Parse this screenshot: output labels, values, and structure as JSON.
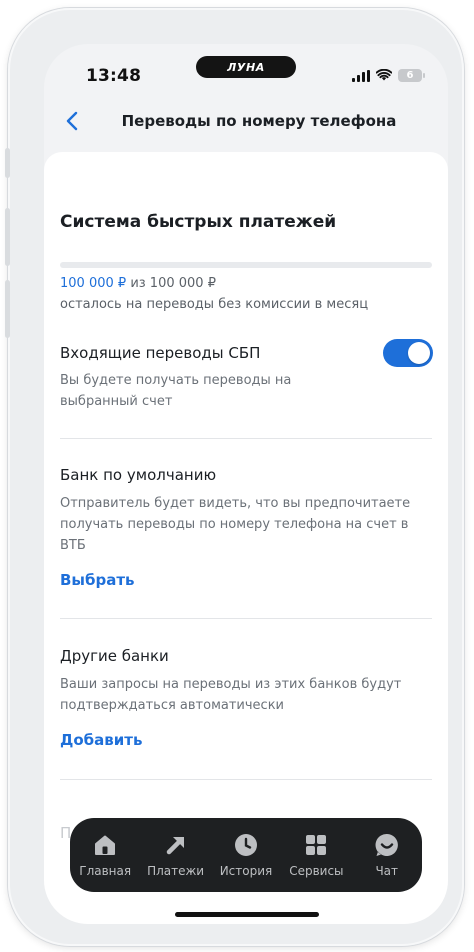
{
  "status_bar": {
    "time": "13:48",
    "island_label": "ЛУНА",
    "battery": "6",
    "icons": [
      "signal-icon",
      "wifi-icon",
      "battery-icon"
    ]
  },
  "header": {
    "back_icon": "chevron-left-icon",
    "title": "Переводы по номеру телефона"
  },
  "sbp": {
    "title": "Система быстрых платежей",
    "limit_used": "100 000 ₽",
    "limit_of": "из 100 000 ₽",
    "limit_desc": "осталось на переводы без комиссии в месяц",
    "remaining_fraction": 1.0
  },
  "incoming": {
    "title": "Входящие переводы СБП",
    "desc": "Вы будете получать переводы на выбранный счет",
    "toggle_on": true
  },
  "default_bank": {
    "title": "Банк по умолчанию",
    "desc": "Отправитель будет видеть, что вы предпочитаете получать переводы по номеру телефона на счет в ВТБ",
    "action": "Выбрать"
  },
  "other_banks": {
    "title": "Другие банки",
    "desc": "Ваши запросы на переводы из этих банков будут подтверждаться автоматически",
    "action": "Добавить"
  },
  "hidden_row": {
    "text": "П"
  },
  "tabbar": {
    "items": [
      {
        "label": "Главная",
        "icon": "home-icon"
      },
      {
        "label": "Платежи",
        "icon": "arrow-up-right-icon"
      },
      {
        "label": "История",
        "icon": "clock-icon"
      },
      {
        "label": "Сервисы",
        "icon": "grid-icon"
      },
      {
        "label": "Чат",
        "icon": "chat-smile-icon"
      }
    ]
  },
  "colors": {
    "accent": "#1e6fd9",
    "tabbar_bg": "#1e2022",
    "icon_gray": "#bdbfc2"
  }
}
